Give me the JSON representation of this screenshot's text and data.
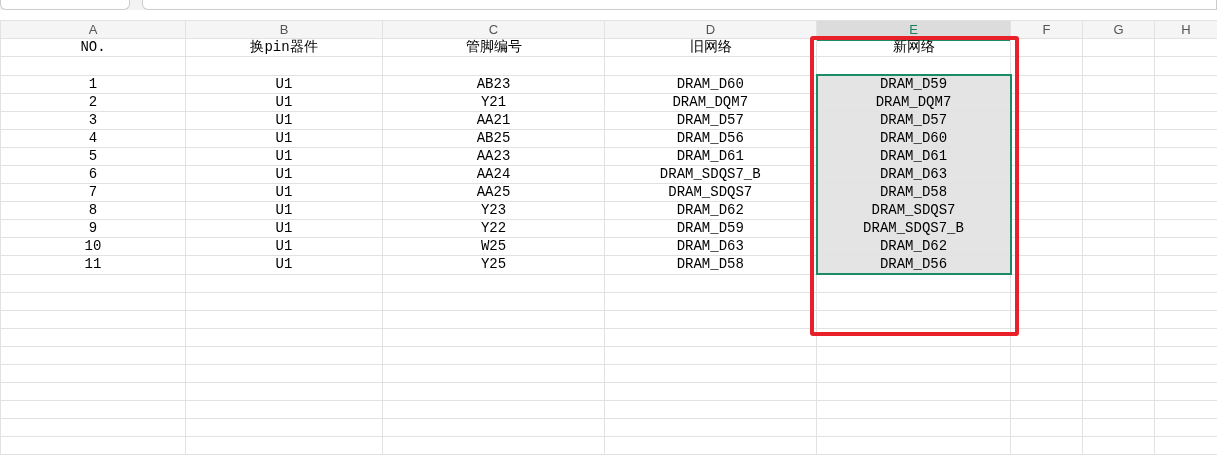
{
  "columns": [
    {
      "label": "A",
      "selected": false
    },
    {
      "label": "B",
      "selected": false
    },
    {
      "label": "C",
      "selected": false
    },
    {
      "label": "D",
      "selected": false
    },
    {
      "label": "E",
      "selected": true
    },
    {
      "label": "F",
      "selected": false
    },
    {
      "label": "G",
      "selected": false
    },
    {
      "label": "H",
      "selected": false
    }
  ],
  "header_row": [
    "NO.",
    "换pin器件",
    "管脚编号",
    "旧网络",
    "新网络"
  ],
  "rows": [
    {
      "cells": [
        "1",
        "U1",
        "AB23",
        "DRAM_D60",
        "DRAM_D59"
      ],
      "selected": true
    },
    {
      "cells": [
        "2",
        "U1",
        "Y21",
        "DRAM_DQM7",
        "DRAM_DQM7"
      ],
      "selected": true
    },
    {
      "cells": [
        "3",
        "U1",
        "AA21",
        "DRAM_D57",
        "DRAM_D57"
      ],
      "selected": true
    },
    {
      "cells": [
        "4",
        "U1",
        "AB25",
        "DRAM_D56",
        "DRAM_D60"
      ],
      "selected": true
    },
    {
      "cells": [
        "5",
        "U1",
        "AA23",
        "DRAM_D61",
        "DRAM_D61"
      ],
      "selected": true
    },
    {
      "cells": [
        "6",
        "U1",
        "AA24",
        "DRAM_SDQS7_B",
        "DRAM_D63"
      ],
      "selected": true
    },
    {
      "cells": [
        "7",
        "U1",
        "AA25",
        "DRAM_SDQS7",
        "DRAM_D58"
      ],
      "selected": true
    },
    {
      "cells": [
        "8",
        "U1",
        "Y23",
        "DRAM_D62",
        "DRAM_SDQS7"
      ],
      "selected": true
    },
    {
      "cells": [
        "9",
        "U1",
        "Y22",
        "DRAM_D59",
        "DRAM_SDQS7_B"
      ],
      "selected": true
    },
    {
      "cells": [
        "10",
        "U1",
        "W25",
        "DRAM_D63",
        "DRAM_D62"
      ],
      "selected": true
    },
    {
      "cells": [
        "11",
        "U1",
        "Y25",
        "DRAM_D58",
        "DRAM_D56"
      ],
      "selected": true
    }
  ]
}
